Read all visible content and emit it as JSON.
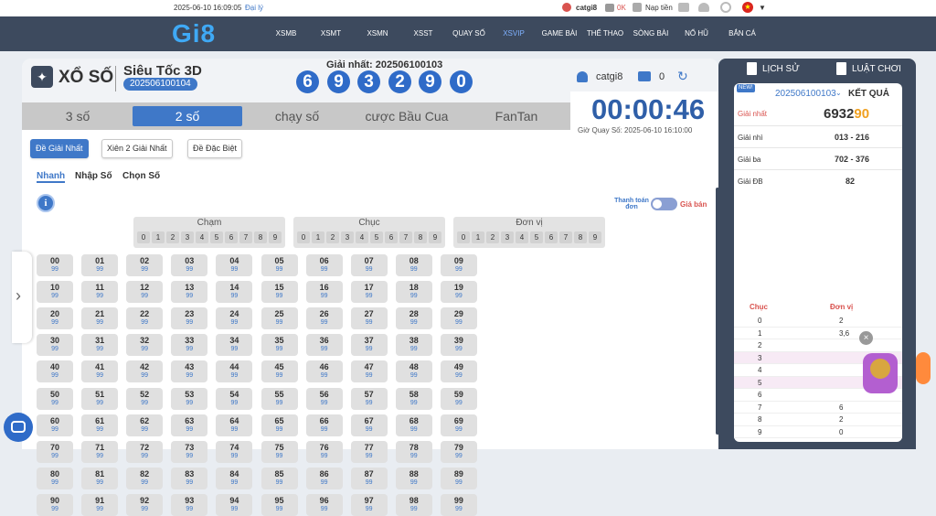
{
  "topbar": {
    "datetime": "2025-06-10 16:09:05",
    "agent": "Đại lý",
    "user": "catgi8",
    "balance": "0K",
    "deposit": "Nạp tiền"
  },
  "nav": {
    "logo": "Gi8",
    "items": [
      "XSMB",
      "XSMT",
      "XSMN",
      "XSST",
      "QUAY SỐ",
      "XSVIP",
      "GAME BÀI",
      "THỂ THAO",
      "SÒNG BÀI",
      "NỔ HŨ",
      "BẮN CÁ"
    ],
    "active": "XSVIP"
  },
  "game": {
    "name": "XỔ SỐ",
    "title": "Siêu Tốc 3D",
    "draw_id": "202506100104",
    "prize_label": "Giải nhất: 202506100103",
    "balls": [
      "6",
      "9",
      "3",
      "2",
      "9",
      "0"
    ],
    "user": "catgi8",
    "cart_count": "0",
    "timer": "00:00:46",
    "draw_time": "Giờ Quay Số: 2025-06-10 16:10:00"
  },
  "tabs": [
    "3 số",
    "2 số",
    "chạy số",
    "cược Bầu Cua",
    "FanTan"
  ],
  "active_tab": "2 số",
  "bet_types": [
    "Đề Giải Nhất",
    "Xiên 2 Giải Nhất",
    "Đề Đặc Biệt"
  ],
  "modes": [
    "Nhanh",
    "Nhập Số",
    "Chọn Số"
  ],
  "toggle": {
    "left": "Thanh toán đơn",
    "right": "Giá bán"
  },
  "filters": [
    {
      "title": "Chạm",
      "digits": [
        "0",
        "1",
        "2",
        "3",
        "4",
        "5",
        "6",
        "7",
        "8",
        "9"
      ]
    },
    {
      "title": "Chục",
      "digits": [
        "0",
        "1",
        "2",
        "3",
        "4",
        "5",
        "6",
        "7",
        "8",
        "9"
      ]
    },
    {
      "title": "Đơn vị",
      "digits": [
        "0",
        "1",
        "2",
        "3",
        "4",
        "5",
        "6",
        "7",
        "8",
        "9"
      ]
    }
  ],
  "rate": "99",
  "side": {
    "history": "LỊCH SỬ",
    "rules": "LUẬT CHƠI",
    "new_badge": "NEW!",
    "period": "202506100103",
    "result_label": "KẾT QUẢ",
    "prizes": [
      {
        "label": "Giải nhất",
        "value_main": "6932",
        "value_accent": "90"
      },
      {
        "label": "Giải nhì",
        "value": "013 - 216"
      },
      {
        "label": "Giải ba",
        "value": "702 - 376"
      },
      {
        "label": "Giải ĐB",
        "value": "82"
      }
    ],
    "stats_headers": [
      "Chục",
      "Đơn vị"
    ],
    "stats": [
      [
        "0",
        "2"
      ],
      [
        "1",
        "3,6"
      ],
      [
        "2",
        ""
      ],
      [
        "3",
        ""
      ],
      [
        "4",
        ""
      ],
      [
        "5",
        ""
      ],
      [
        "6",
        ""
      ],
      [
        "7",
        "6"
      ],
      [
        "8",
        "2"
      ],
      [
        "9",
        "0"
      ]
    ]
  }
}
